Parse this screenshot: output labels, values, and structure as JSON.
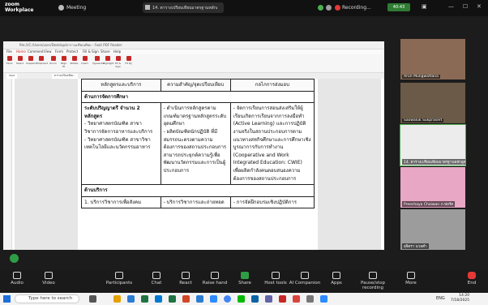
{
  "zoom": {
    "logo_line1": "zoom",
    "logo_line2": "Workplace",
    "meeting_label": "Meeting",
    "share_tab_title": "14. ตารางเปรียบเทียบมาตรฐานหลักสูตร",
    "recording_label": "Recording...",
    "time_remaining": "40:43"
  },
  "pdf": {
    "window_title": "file:///C:/Users/user/Desktop/ตารางเปรียบเทียบ - Foxit PDF Reader",
    "menus": [
      "File",
      "Home",
      "Comment",
      "View",
      "Form",
      "Protect",
      "Fill & Sign",
      "Share",
      "Help"
    ],
    "ribbon": [
      "Hand",
      "Select",
      "Snapshot",
      "Clipboard",
      "Zoom",
      "Page Fit",
      "Rotate",
      "Insert",
      "Typewriter",
      "Highlight",
      "Fill & Sign",
      "Fit Pg"
    ],
    "tabs": [
      "Start",
      "ตารางเปรียบเทียบ..."
    ]
  },
  "table": {
    "headers": [
      "หลักสูตรและบริการ",
      "ความสำคัญ/จุดเปรียบเทียบ",
      "กลไกการส่งมอบ"
    ],
    "section1": "ด้านการจัดการศึกษา",
    "c1_title": "ระดับปริญญาตรี จำนวน 2 หลักสูตร",
    "c1_items": [
      "- วิทยาศาสตรบัณฑิต สาขาวิชาการจัดการอาหารและบริการ",
      "- วิทยาศาสตรบัณฑิต สาขาวิชาเทคโนโลยีและนวัตกรรมอาหาร"
    ],
    "c2_items": [
      "- ดำเนินการหลักสูตรตามเกณฑ์มาตรฐานหลักสูตรระดับอุดมศึกษา",
      "- ผลิตบัณฑิตนักปฏิบัติ ที่มีสมรรถนะตรงตามความต้องการของสถานประกอบการ สามารถประยุกต์ความรู้เพื่อพัฒนานวัตกรรมและการเป็นผู้ประกอบการ"
    ],
    "c3_items": [
      "- จัดการเรียนการสอนส่งเสริมให้ผู้เรียนเกิดการเรียนจากการลงมือทำ (Active Learning) และการปฏิบัติงานจริงในสถานประกอบการตามแนวทางสหกิจศึกษาและการศึกษาเชิงบูรณาการกับการทำงาน (Cooperative and Work Integrated Education: CWIE) เพื่อผลิตกำลังคนตอบสนองความต้องการของสถานประกอบการ"
    ],
    "section2": "ด้านบริการ",
    "s2_c1": "1. บริการวิชาการเพื่อสังคม",
    "s2_c2": "- บริการวิชาการและถ่ายทอด",
    "s2_c3": "- การจัดฝึกอบรมเชิงปฏิบัติการ"
  },
  "participants": [
    {
      "name": "Arun Mungwattana",
      "bg": "#8a6a55"
    },
    {
      "name": "Saowaluk Sukprasert",
      "bg": "#6b5a48"
    },
    {
      "name": "14. ตารางเปรียบเทียบมาตรฐานหลักสูตร",
      "bg": "#ececec"
    },
    {
      "name": "Preechaya Chaiwan ภ.ฟอร์ด",
      "bg": "#e8a7c4"
    },
    {
      "name": "สุจิตรา นวลคำ",
      "bg": "#9c9c9c"
    }
  ],
  "toolbar": [
    {
      "label": "Audio",
      "icon": "microphone-icon"
    },
    {
      "label": "Video",
      "icon": "video-camera-icon"
    },
    {
      "label": "Participants",
      "icon": "participants-icon",
      "count": "15"
    },
    {
      "label": "Chat",
      "icon": "chat-icon"
    },
    {
      "label": "React",
      "icon": "heart-icon"
    },
    {
      "label": "Raise hand",
      "icon": "hand-icon"
    },
    {
      "label": "Share",
      "icon": "share-screen-icon"
    },
    {
      "label": "Host tools",
      "icon": "shield-icon"
    },
    {
      "label": "AI Companion",
      "icon": "sparkle-icon"
    },
    {
      "label": "Apps",
      "icon": "apps-icon"
    },
    {
      "label": "Pause/stop recording",
      "icon": "record-icon"
    },
    {
      "label": "More",
      "icon": "ellipsis-icon"
    },
    {
      "label": "End",
      "icon": "end-icon"
    }
  ],
  "taskbar": {
    "search_placeholder": "Type here to search",
    "language": "ENG",
    "time": "14:20",
    "date": "7/18/2025"
  }
}
